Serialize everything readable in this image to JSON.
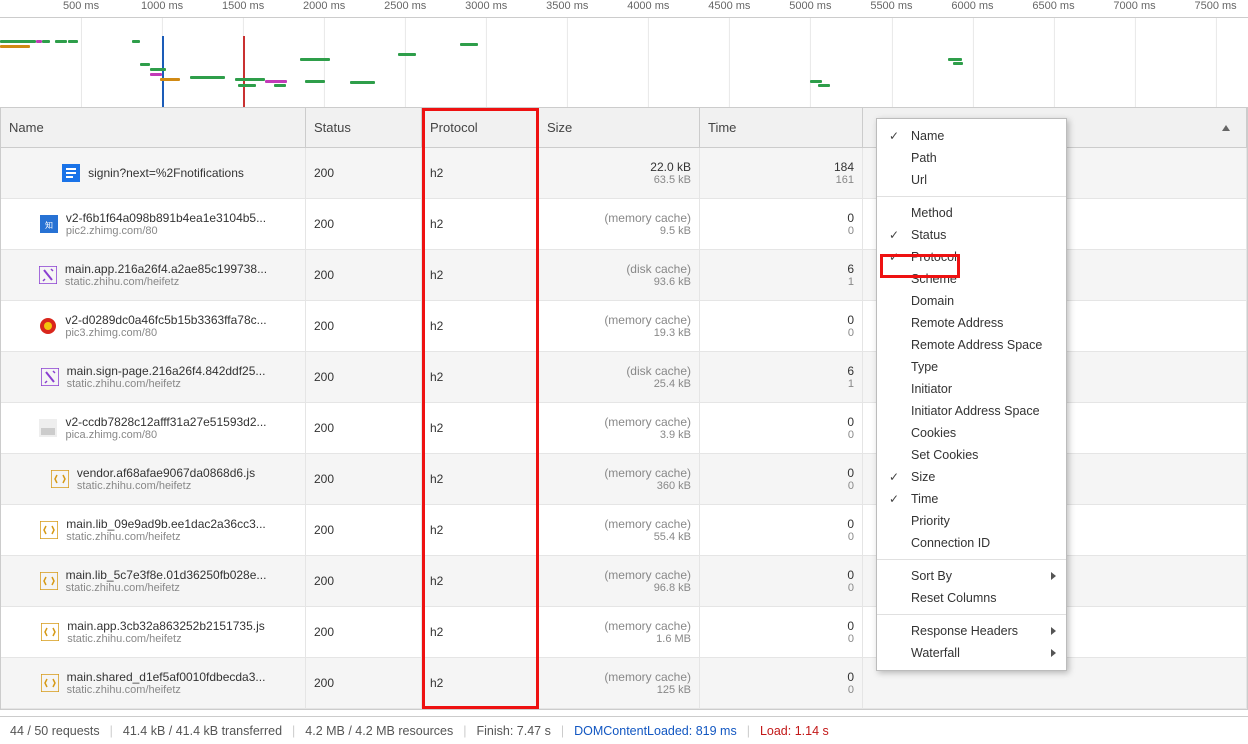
{
  "timeline": {
    "ticks_ms": [
      500,
      1000,
      1500,
      2000,
      2500,
      3000,
      3500,
      4000,
      4500,
      5000,
      5500,
      6000,
      6500,
      7000,
      7500
    ],
    "tick_suffix": " ms",
    "vline_blue_ms": 1000,
    "vline_red_ms": 1500
  },
  "columns": {
    "name": "Name",
    "status": "Status",
    "protocol": "Protocol",
    "size": "Size",
    "time": "Time"
  },
  "rows": [
    {
      "icon": "document",
      "name": "signin?next=%2Fnotifications",
      "sub": "",
      "status": "200",
      "protocol": "h2",
      "size1": "22.0 kB",
      "size2": "63.5 kB",
      "time1": "184",
      "time2": "161"
    },
    {
      "icon": "img-blue",
      "name": "v2-f6b1f64a098b891b4ea1e3104b5...",
      "sub": "pic2.zhimg.com/80",
      "status": "200",
      "protocol": "h2",
      "size1": "(memory cache)",
      "size2": "9.5 kB",
      "time1": "0",
      "time2": "0"
    },
    {
      "icon": "css",
      "name": "main.app.216a26f4.a2ae85c199738...",
      "sub": "static.zhihu.com/heifetz",
      "status": "200",
      "protocol": "h2",
      "size1": "(disk cache)",
      "size2": "93.6 kB",
      "time1": "6",
      "time2": "1"
    },
    {
      "icon": "img-red",
      "name": "v2-d0289dc0a46fc5b15b3363ffa78c...",
      "sub": "pic3.zhimg.com/80",
      "status": "200",
      "protocol": "h2",
      "size1": "(memory cache)",
      "size2": "19.3 kB",
      "time1": "0",
      "time2": "0"
    },
    {
      "icon": "css",
      "name": "main.sign-page.216a26f4.842ddf25...",
      "sub": "static.zhihu.com/heifetz",
      "status": "200",
      "protocol": "h2",
      "size1": "(disk cache)",
      "size2": "25.4 kB",
      "time1": "6",
      "time2": "1"
    },
    {
      "icon": "img-plain",
      "name": "v2-ccdb7828c12afff31a27e51593d2...",
      "sub": "pica.zhimg.com/80",
      "status": "200",
      "protocol": "h2",
      "size1": "(memory cache)",
      "size2": "3.9 kB",
      "time1": "0",
      "time2": "0"
    },
    {
      "icon": "js",
      "name": "vendor.af68afae9067da0868d6.js",
      "sub": "static.zhihu.com/heifetz",
      "status": "200",
      "protocol": "h2",
      "size1": "(memory cache)",
      "size2": "360 kB",
      "time1": "0",
      "time2": "0"
    },
    {
      "icon": "js",
      "name": "main.lib_09e9ad9b.ee1dac2a36cc3...",
      "sub": "static.zhihu.com/heifetz",
      "status": "200",
      "protocol": "h2",
      "size1": "(memory cache)",
      "size2": "55.4 kB",
      "time1": "0",
      "time2": "0"
    },
    {
      "icon": "js",
      "name": "main.lib_5c7e3f8e.01d36250fb028e...",
      "sub": "static.zhihu.com/heifetz",
      "status": "200",
      "protocol": "h2",
      "size1": "(memory cache)",
      "size2": "96.8 kB",
      "time1": "0",
      "time2": "0"
    },
    {
      "icon": "js",
      "name": "main.app.3cb32a863252b2151735.js",
      "sub": "static.zhihu.com/heifetz",
      "status": "200",
      "protocol": "h2",
      "size1": "(memory cache)",
      "size2": "1.6 MB",
      "time1": "0",
      "time2": "0"
    },
    {
      "icon": "js",
      "name": "main.shared_d1ef5af0010fdbecda3...",
      "sub": "static.zhihu.com/heifetz",
      "status": "200",
      "protocol": "h2",
      "size1": "(memory cache)",
      "size2": "125 kB",
      "time1": "0",
      "time2": "0"
    }
  ],
  "context_menu": {
    "items": [
      {
        "label": "Name",
        "checked": true
      },
      {
        "label": "Path"
      },
      {
        "label": "Url"
      },
      {
        "sep": true
      },
      {
        "label": "Method"
      },
      {
        "label": "Status",
        "checked": true
      },
      {
        "label": "Protocol",
        "checked": true
      },
      {
        "label": "Scheme"
      },
      {
        "label": "Domain"
      },
      {
        "label": "Remote Address"
      },
      {
        "label": "Remote Address Space"
      },
      {
        "label": "Type"
      },
      {
        "label": "Initiator"
      },
      {
        "label": "Initiator Address Space"
      },
      {
        "label": "Cookies"
      },
      {
        "label": "Set Cookies"
      },
      {
        "label": "Size",
        "checked": true
      },
      {
        "label": "Time",
        "checked": true
      },
      {
        "label": "Priority"
      },
      {
        "label": "Connection ID"
      },
      {
        "sep": true
      },
      {
        "label": "Sort By",
        "submenu": true
      },
      {
        "label": "Reset Columns"
      },
      {
        "sep": true
      },
      {
        "label": "Response Headers",
        "submenu": true
      },
      {
        "label": "Waterfall",
        "submenu": true
      }
    ]
  },
  "status_bar": {
    "requests": "44 / 50 requests",
    "transferred": "41.4 kB / 41.4 kB transferred",
    "resources": "4.2 MB / 4.2 MB resources",
    "finish": "Finish: 7.47 s",
    "dom": "DOMContentLoaded: 819 ms",
    "load": "Load: 1.14 s"
  }
}
